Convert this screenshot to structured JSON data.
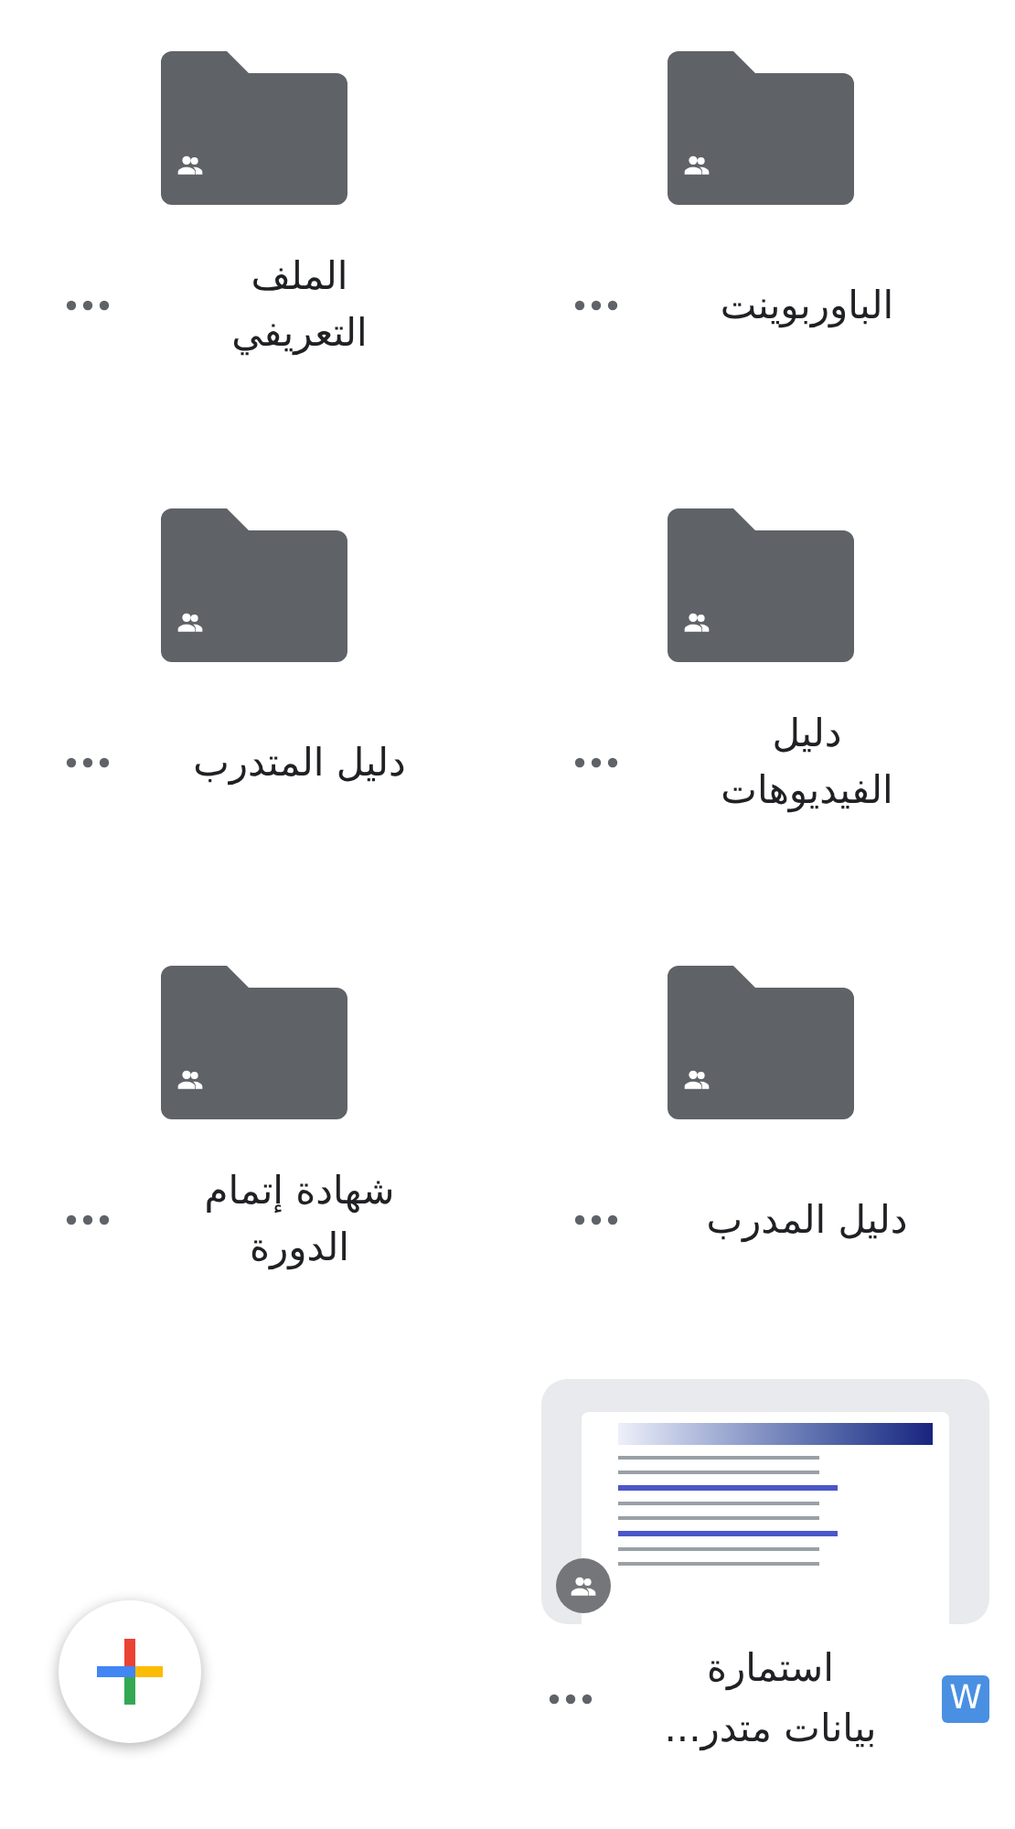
{
  "items": [
    {
      "kind": "folder",
      "name": "الباوربوينت",
      "shared": true
    },
    {
      "kind": "folder",
      "name": "الملف التعريفي",
      "shared": true
    },
    {
      "kind": "folder",
      "name": "دليل الفيديوهات",
      "shared": true
    },
    {
      "kind": "folder",
      "name": "دليل المتدرب",
      "shared": true
    },
    {
      "kind": "folder",
      "name": "دليل المدرب",
      "shared": true
    },
    {
      "kind": "folder",
      "name": "شهادة إتمام الدورة",
      "shared": true
    },
    {
      "kind": "document",
      "name": "استمارة بيانات متدر...",
      "shared": true,
      "type_badge": "W"
    }
  ],
  "fab": {
    "kind": "new"
  }
}
